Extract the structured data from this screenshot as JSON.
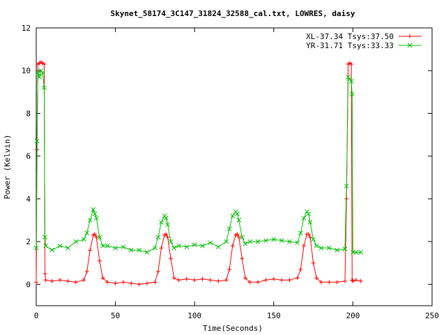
{
  "chart_data": {
    "type": "line",
    "title": "Skynet_58174_3C147_31824_32588_cal.txt, LOWRES, daisy",
    "xlabel": "Time(Seconds)",
    "ylabel": "Power (Kelvin)",
    "xlim": [
      0,
      250
    ],
    "ylim": [
      -1,
      12
    ],
    "xticks": [
      0,
      50,
      100,
      150,
      200,
      250
    ],
    "yticks": [
      0,
      2,
      4,
      6,
      8,
      10,
      12
    ],
    "grid": false,
    "legend_position": "top-right",
    "series": [
      {
        "name": "XL-37.34 Tsys:37.50",
        "color": "#ff0000",
        "marker": "plus",
        "x": [
          0,
          0.5,
          1,
          2,
          3,
          4,
          5,
          5.5,
          6,
          10,
          15,
          20,
          25,
          30,
          32,
          34,
          36,
          37,
          38,
          40,
          42,
          45,
          50,
          55,
          60,
          65,
          70,
          75,
          77,
          79,
          81,
          82,
          83,
          85,
          87,
          90,
          95,
          100,
          105,
          110,
          115,
          120,
          122,
          124,
          126,
          127,
          128,
          130,
          132,
          135,
          140,
          145,
          150,
          155,
          160,
          165,
          167,
          169,
          171,
          172,
          173,
          175,
          177,
          180,
          185,
          190,
          195,
          196,
          197,
          198,
          199,
          199.5,
          200,
          202,
          205
        ],
        "y": [
          0.1,
          6.3,
          10.3,
          10.35,
          10.4,
          10.35,
          10.3,
          0.5,
          0.2,
          0.15,
          0.2,
          0.15,
          0.1,
          0.2,
          0.6,
          1.6,
          2.3,
          2.35,
          2.2,
          1.1,
          0.3,
          0.1,
          0.05,
          0.1,
          0.05,
          0.0,
          0.05,
          0.1,
          0.6,
          1.7,
          2.3,
          2.35,
          2.2,
          1.2,
          0.3,
          0.2,
          0.25,
          0.2,
          0.25,
          0.2,
          0.15,
          0.2,
          0.7,
          1.8,
          2.3,
          2.35,
          2.2,
          1.2,
          0.3,
          0.1,
          0.1,
          0.2,
          0.25,
          0.2,
          0.2,
          0.3,
          0.7,
          1.8,
          2.35,
          2.35,
          2.2,
          1.0,
          0.3,
          0.1,
          0.1,
          0.1,
          0.15,
          4.0,
          10.3,
          10.35,
          10.3,
          0.2,
          0.15,
          0.2,
          0.15
        ]
      },
      {
        "name": "YR-31.71 Tsys:33.33",
        "color": "#00c000",
        "marker": "cross",
        "x": [
          0,
          0.5,
          1,
          2,
          3,
          4,
          5,
          5.5,
          6,
          10,
          15,
          20,
          25,
          30,
          32,
          34,
          36,
          37,
          38,
          40,
          42,
          45,
          50,
          55,
          60,
          65,
          70,
          75,
          77,
          79,
          81,
          82,
          83,
          85,
          87,
          90,
          95,
          100,
          105,
          110,
          115,
          120,
          122,
          124,
          126,
          127,
          128,
          130,
          132,
          135,
          140,
          145,
          150,
          155,
          160,
          165,
          167,
          169,
          171,
          172,
          173,
          175,
          177,
          180,
          185,
          190,
          195,
          196,
          197,
          198,
          199,
          199.5,
          200,
          202,
          205
        ],
        "y": [
          1.7,
          6.7,
          9.9,
          9.7,
          10.0,
          9.9,
          9.2,
          2.2,
          1.8,
          1.6,
          1.8,
          1.7,
          2.0,
          2.1,
          2.4,
          3.0,
          3.5,
          3.3,
          3.1,
          2.2,
          1.8,
          1.8,
          1.7,
          1.75,
          1.6,
          1.6,
          1.5,
          1.7,
          2.2,
          2.9,
          3.2,
          3.1,
          2.8,
          2.0,
          1.7,
          1.8,
          1.75,
          1.85,
          1.8,
          1.95,
          1.75,
          2.0,
          2.6,
          3.2,
          3.4,
          3.3,
          3.0,
          2.2,
          1.9,
          2.0,
          2.0,
          2.05,
          2.1,
          2.05,
          2.0,
          1.95,
          2.4,
          3.1,
          3.4,
          3.3,
          2.9,
          2.1,
          1.8,
          1.7,
          1.7,
          1.6,
          1.65,
          4.6,
          9.7,
          9.6,
          9.5,
          8.9,
          1.5,
          1.5,
          1.5
        ]
      }
    ]
  }
}
